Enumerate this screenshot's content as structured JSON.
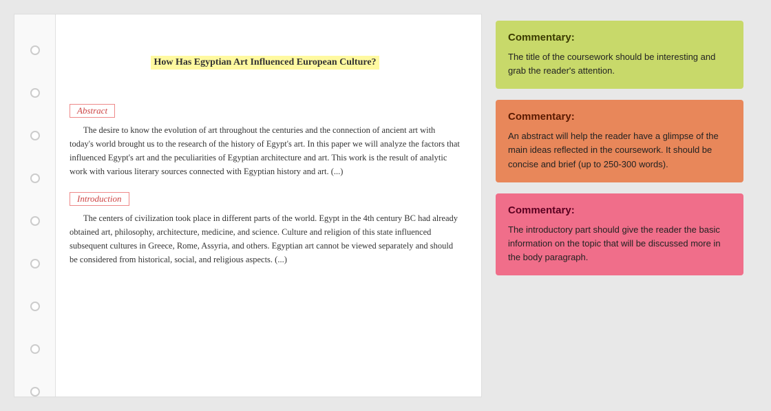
{
  "document": {
    "title": "How Has Egyptian Art Influenced European Culture?",
    "abstract_label": "Abstract",
    "abstract_text": "The desire to know the evolution of art throughout the centuries and the connection of ancient art with today's world brought us to the research of the history of Egypt's art. In this paper we will analyze the factors that influenced Egypt's art and the peculiarities of Egyptian architecture and art. This work is the result of analytic work with various literary sources connected with Egyptian history and art. (...)",
    "introduction_label": "Introduction",
    "introduction_text": "The centers of civilization took place in different parts of the world. Egypt in the 4th century BC had already obtained art, philosophy, architecture, medicine, and science. Culture and religion of this state influenced subsequent cultures in Greece, Rome, Assyria, and others. Egyptian art cannot be viewed separately and should be considered from historical, social, and religious aspects. (...)"
  },
  "commentary": {
    "cards": [
      {
        "id": "title-commentary",
        "theme": "green",
        "title": "Commentary:",
        "text": "The title of the coursework should be interesting and grab the reader's attention."
      },
      {
        "id": "abstract-commentary",
        "theme": "orange",
        "title": "Commentary:",
        "text": "An abstract will help the reader have a glimpse of the main ideas reflected in the coursework. It should be concise and brief (up to 250-300 words)."
      },
      {
        "id": "intro-commentary",
        "theme": "pink",
        "title": "Commentary:",
        "text": "The introductory part should give the reader the basic information on the topic that will be discussed more in the body paragraph."
      }
    ]
  },
  "sidebar": {
    "radio_count": 9
  }
}
